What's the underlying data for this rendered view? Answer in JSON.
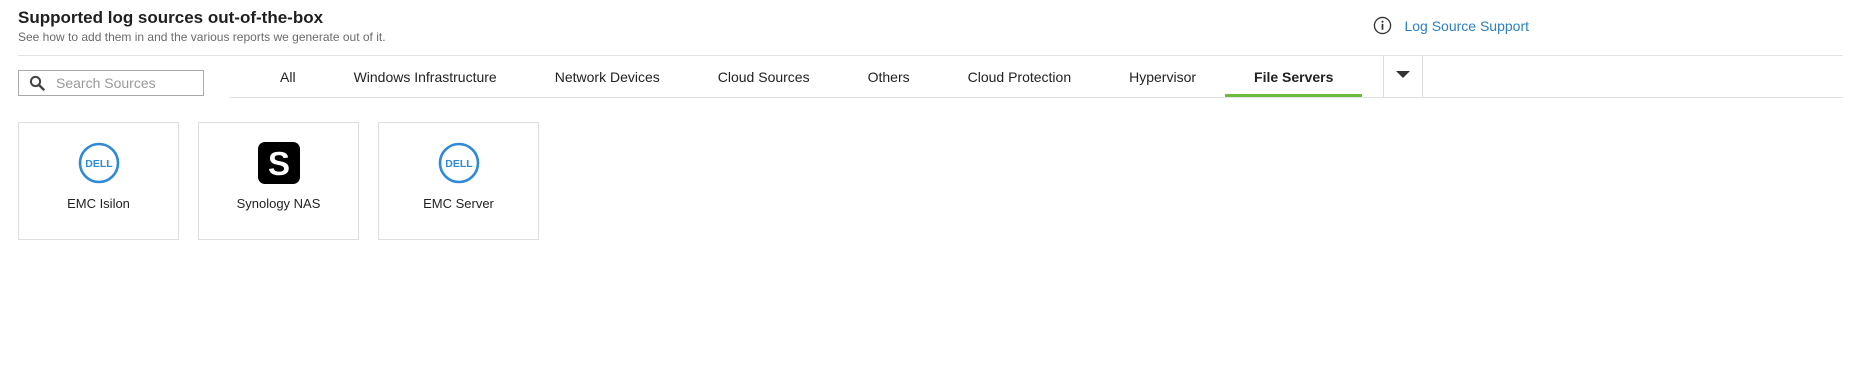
{
  "header": {
    "title": "Supported log sources out-of-the-box",
    "subtitle": "See how to add them in and the various reports we generate out of it."
  },
  "support": {
    "label": "Log Source Support",
    "icon": "info-icon"
  },
  "search": {
    "placeholder": "Search Sources",
    "value": "",
    "icon": "search-icon"
  },
  "tabs": [
    {
      "label": "All"
    },
    {
      "label": "Windows Infrastructure"
    },
    {
      "label": "Network Devices"
    },
    {
      "label": "Cloud Sources"
    },
    {
      "label": "Others"
    },
    {
      "label": "Cloud Protection"
    },
    {
      "label": "Hypervisor"
    },
    {
      "label": "File Servers",
      "active": true
    }
  ],
  "more_tabs": {
    "icon": "caret-down-icon"
  },
  "cards": [
    {
      "name": "EMC Isilon",
      "logo": "dell-logo",
      "logo_text": "DELL"
    },
    {
      "name": "Synology NAS",
      "logo": "synology-logo",
      "logo_text": "S"
    },
    {
      "name": "EMC Server",
      "logo": "dell-logo",
      "logo_text": "DELL"
    }
  ],
  "colors": {
    "accent_link": "#2c7fc0",
    "active_tab_underline": "#6cbb3c",
    "dell_blue": "#2e8ad6"
  }
}
